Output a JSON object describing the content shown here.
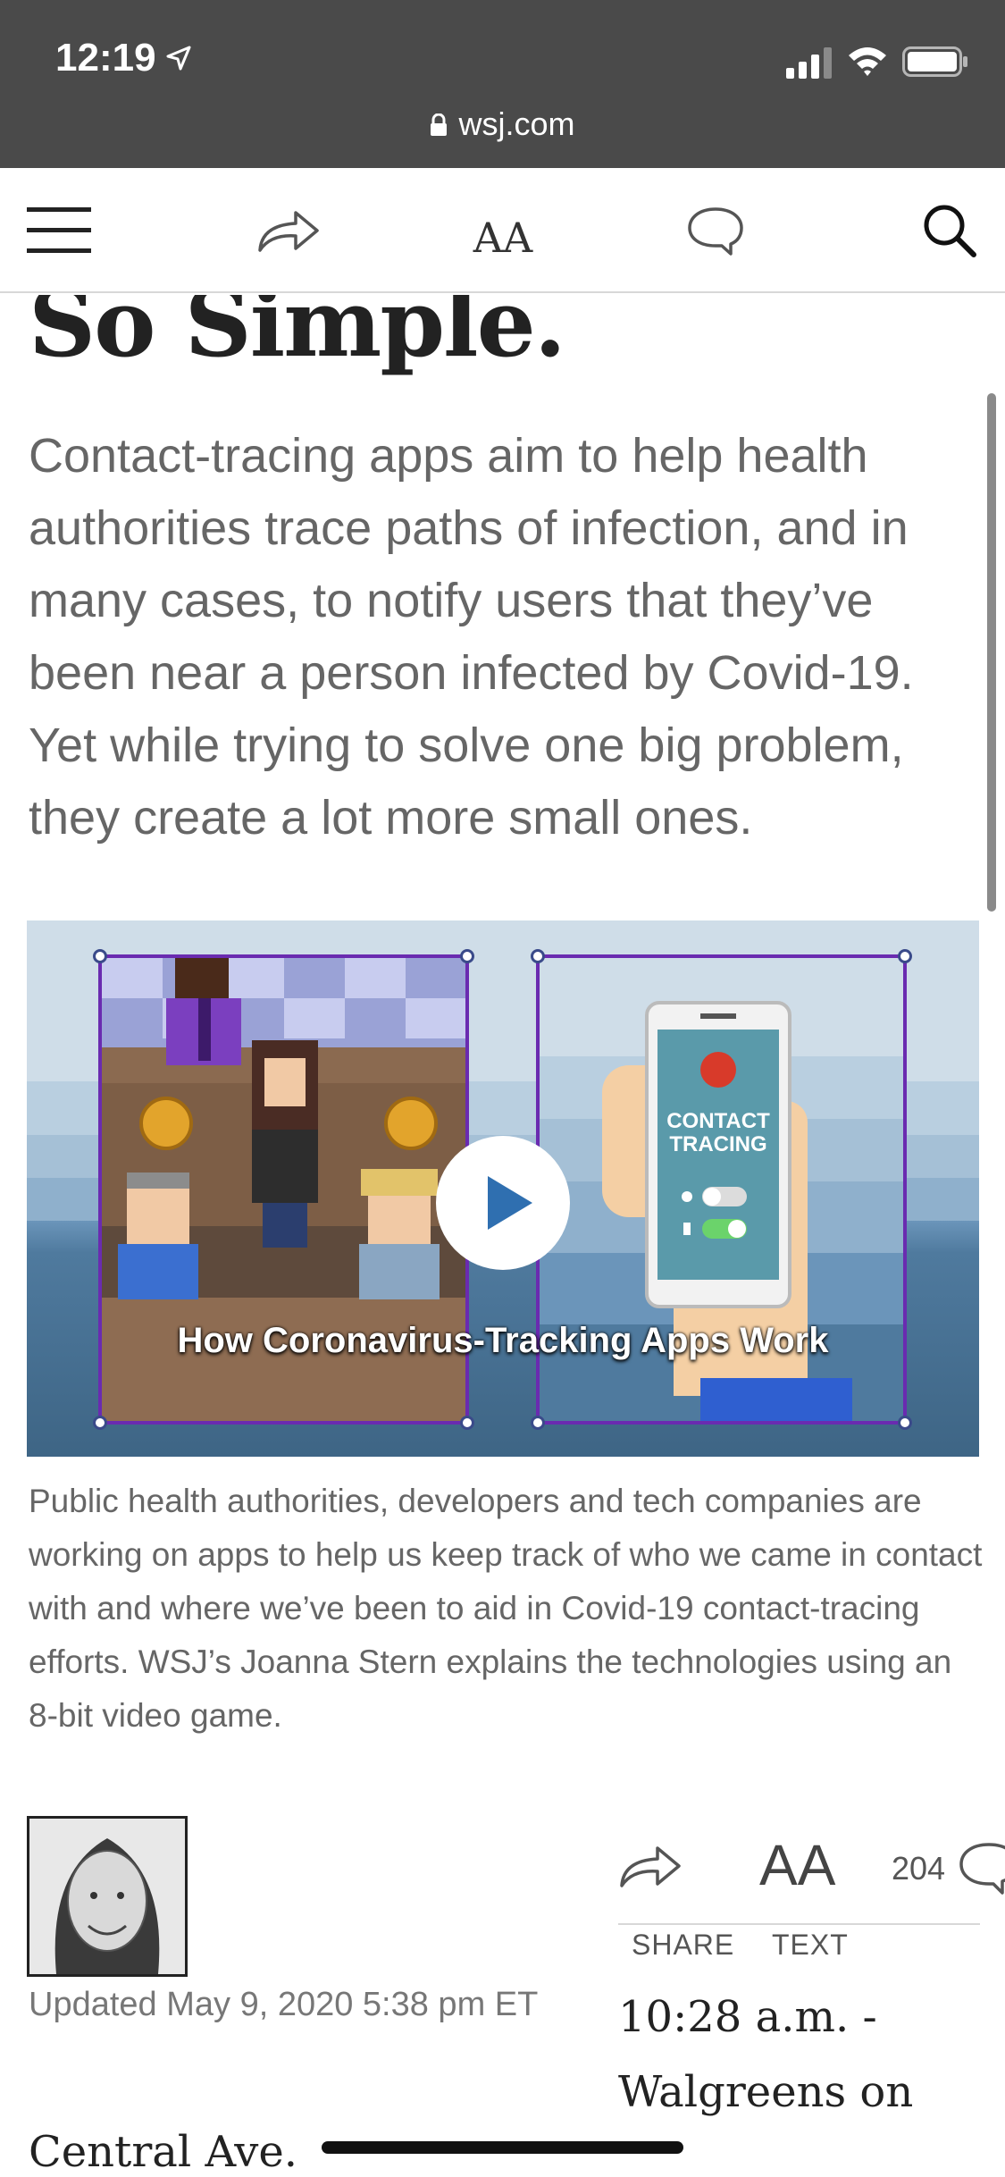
{
  "status_bar": {
    "time": "12:19"
  },
  "browser": {
    "url": "wsj.com"
  },
  "toolbar": {
    "text_size_glyph": "AA"
  },
  "article": {
    "headline_partial": "So Simple.",
    "dek": "Contact-tracing apps aim to help health authorities trace paths of infection, and in many cases, to notify users that they’ve been near a person infected by Covid-19. Yet while trying to solve one big problem, they create a lot more small ones.",
    "video": {
      "title": "How Coronavirus-Tracking Apps Work",
      "phone_label_line1": "CONTACT",
      "phone_label_line2": "TRACING"
    },
    "caption": "Public health authorities, developers and tech companies are working on apps to help us keep track of who we came in contact with and where we’ve been to aid in Covid-19 contact-tracing efforts. WSJ’s Joanna Stern explains the technologies using an 8-bit video game.",
    "updated": "Updated May 9, 2020 5:38 pm ET",
    "share_label": "SHARE",
    "text_label": "TEXT",
    "text_glyph": "AA",
    "comment_count": "204",
    "body_right": "10:28 a.m. - Walgreens on",
    "body_continued": "Central Ave."
  },
  "icons": [
    "location-arrow-icon",
    "signal-icon",
    "wifi-icon",
    "battery-icon",
    "lock-icon",
    "menu-icon",
    "share-icon",
    "text-size-icon",
    "comment-icon",
    "search-icon",
    "play-icon"
  ]
}
